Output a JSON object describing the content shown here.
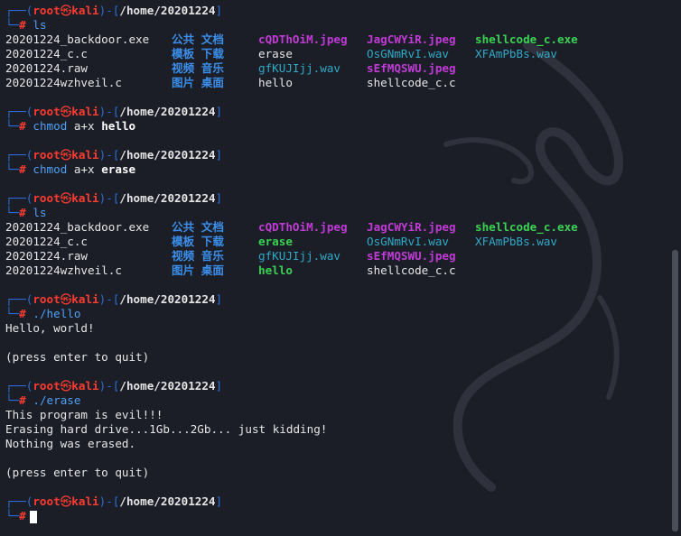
{
  "prompt": {
    "corner_top": "┌──(",
    "user": "root",
    "at": "㉿",
    "host": "kali",
    "close": ")-[",
    "path": "/home/20201224",
    "close_bracket": "]",
    "corner_bot": "└─",
    "hash": "#"
  },
  "blocks": [
    {
      "command": "ls",
      "args": [],
      "listing": [
        [
          {
            "name": "20201224_backdoor.exe",
            "kind": "plain"
          },
          {
            "name": "公共 文档",
            "kind": "dir"
          },
          {
            "name": "cQDThOiM.jpeg",
            "kind": "img"
          },
          {
            "name": "JagCWYiR.jpeg",
            "kind": "img"
          },
          {
            "name": "shellcode_c.exe",
            "kind": "exec"
          }
        ],
        [
          {
            "name": "20201224_c.c",
            "kind": "plain"
          },
          {
            "name": "模板 下载",
            "kind": "dir"
          },
          {
            "name": "erase",
            "kind": "plain"
          },
          {
            "name": "OsGNmRvI.wav",
            "kind": "audio"
          },
          {
            "name": "XFAmPbBs.wav",
            "kind": "audio"
          }
        ],
        [
          {
            "name": "20201224.raw",
            "kind": "plain"
          },
          {
            "name": "视频 音乐",
            "kind": "dir"
          },
          {
            "name": "gfKUJIjj.wav",
            "kind": "audio"
          },
          {
            "name": "sEfMQSWU.jpeg",
            "kind": "img"
          },
          {
            "name": "",
            "kind": "plain"
          }
        ],
        [
          {
            "name": "20201224wzhveil.c",
            "kind": "plain"
          },
          {
            "name": "图片 桌面",
            "kind": "dir"
          },
          {
            "name": "hello",
            "kind": "plain"
          },
          {
            "name": "shellcode_c.c",
            "kind": "plain"
          },
          {
            "name": "",
            "kind": "plain"
          }
        ]
      ]
    },
    {
      "command": "chmod",
      "arg_plain": "a+x",
      "arg_bold": "hello"
    },
    {
      "command": "chmod",
      "arg_plain": "a+x",
      "arg_bold": "erase"
    },
    {
      "command": "ls",
      "listing": [
        [
          {
            "name": "20201224_backdoor.exe",
            "kind": "plain"
          },
          {
            "name": "公共 文档",
            "kind": "dir"
          },
          {
            "name": "cQDThOiM.jpeg",
            "kind": "img"
          },
          {
            "name": "JagCWYiR.jpeg",
            "kind": "img"
          },
          {
            "name": "shellcode_c.exe",
            "kind": "exec"
          }
        ],
        [
          {
            "name": "20201224_c.c",
            "kind": "plain"
          },
          {
            "name": "模板 下载",
            "kind": "dir"
          },
          {
            "name": "erase",
            "kind": "exec"
          },
          {
            "name": "OsGNmRvI.wav",
            "kind": "audio"
          },
          {
            "name": "XFAmPbBs.wav",
            "kind": "audio"
          }
        ],
        [
          {
            "name": "20201224.raw",
            "kind": "plain"
          },
          {
            "name": "视频 音乐",
            "kind": "dir"
          },
          {
            "name": "gfKUJIjj.wav",
            "kind": "audio"
          },
          {
            "name": "sEfMQSWU.jpeg",
            "kind": "img"
          },
          {
            "name": "",
            "kind": "plain"
          }
        ],
        [
          {
            "name": "20201224wzhveil.c",
            "kind": "plain"
          },
          {
            "name": "图片 桌面",
            "kind": "dir"
          },
          {
            "name": "hello",
            "kind": "exec"
          },
          {
            "name": "shellcode_c.c",
            "kind": "plain"
          },
          {
            "name": "",
            "kind": "plain"
          }
        ]
      ]
    },
    {
      "command": "./hello",
      "output": [
        "Hello, world!",
        "",
        "(press enter to quit)"
      ]
    },
    {
      "command": "./erase",
      "output": [
        "This program is evil!!!",
        "Erasing hard drive...1Gb...2Gb... just kidding!",
        "Nothing was erased.",
        "",
        "(press enter to quit)"
      ]
    }
  ],
  "colors": {
    "background": "#1b1e27",
    "prompt_line": "#2b6ed8",
    "root": "#ff3b30",
    "command": "#4ea0f5",
    "dir": "#3b8eea",
    "img": "#c13bd6",
    "audio": "#2fa9c5",
    "exec": "#39d353"
  },
  "icons": {
    "scrollbar": "scrollbar-thumb",
    "background": "kali-dragon-watermark"
  }
}
